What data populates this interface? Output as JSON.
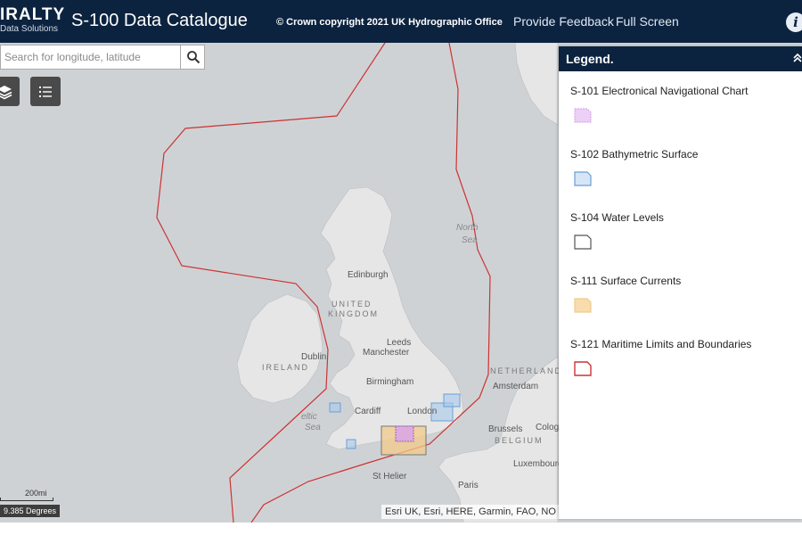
{
  "header": {
    "logo_main": "IRALTY",
    "logo_sub": "Data Solutions",
    "title": "S-100 Data Catalogue",
    "copyright": "© Crown copyright 2021 UK Hydrographic Office",
    "links": [
      {
        "label": "Provide Feedback"
      },
      {
        "label": "Full Screen"
      }
    ],
    "info_glyph": "i"
  },
  "search": {
    "placeholder": "Search for longitude, latitude",
    "icon": "search-icon"
  },
  "map_buttons": {
    "layers_icon": "layers-icon",
    "legend_icon": "legend-list-icon"
  },
  "map": {
    "labels": {
      "edinburgh": "Edinburgh",
      "united": "UNITED",
      "kingdom": "KINGDOM",
      "leeds": "Leeds",
      "manchester": "Manchester",
      "dublin": "Dublin",
      "ireland": "IRELAND",
      "birmingham": "Birmingham",
      "cardiff": "Cardiff",
      "london": "London",
      "celtic": "eltic",
      "celtic_sea": "Sea",
      "north": "North",
      "north_sea": "Sea",
      "netherlands": "NETHERLANDS",
      "amsterdam": "Amsterdam",
      "brussels": "Brussels",
      "belgium": "BELGIUM",
      "cologne": "Colog",
      "luxembourg": "Luxembourg",
      "paris": "Paris",
      "st_helier": "St Helier"
    },
    "scale_label": "200mi",
    "coordinates": "9.385 Degrees",
    "attribution": "Esri UK, Esri, HERE, Garmin, FAO, NO"
  },
  "legend": {
    "title": "Legend.",
    "collapse_icon": "chevron-up-icon",
    "items": [
      {
        "label": "S-101 Electronical Navigational Chart",
        "color": "#d9a6e8"
      },
      {
        "label": "S-102 Bathymetric Surface",
        "color": "#6a9ed6"
      },
      {
        "label": "S-104 Water Levels",
        "color": "#555555"
      },
      {
        "label": "S-111 Surface Currents",
        "color": "#f3c98a"
      },
      {
        "label": "S-121 Maritime Limits and Boundaries",
        "color": "#cc3333"
      }
    ]
  }
}
